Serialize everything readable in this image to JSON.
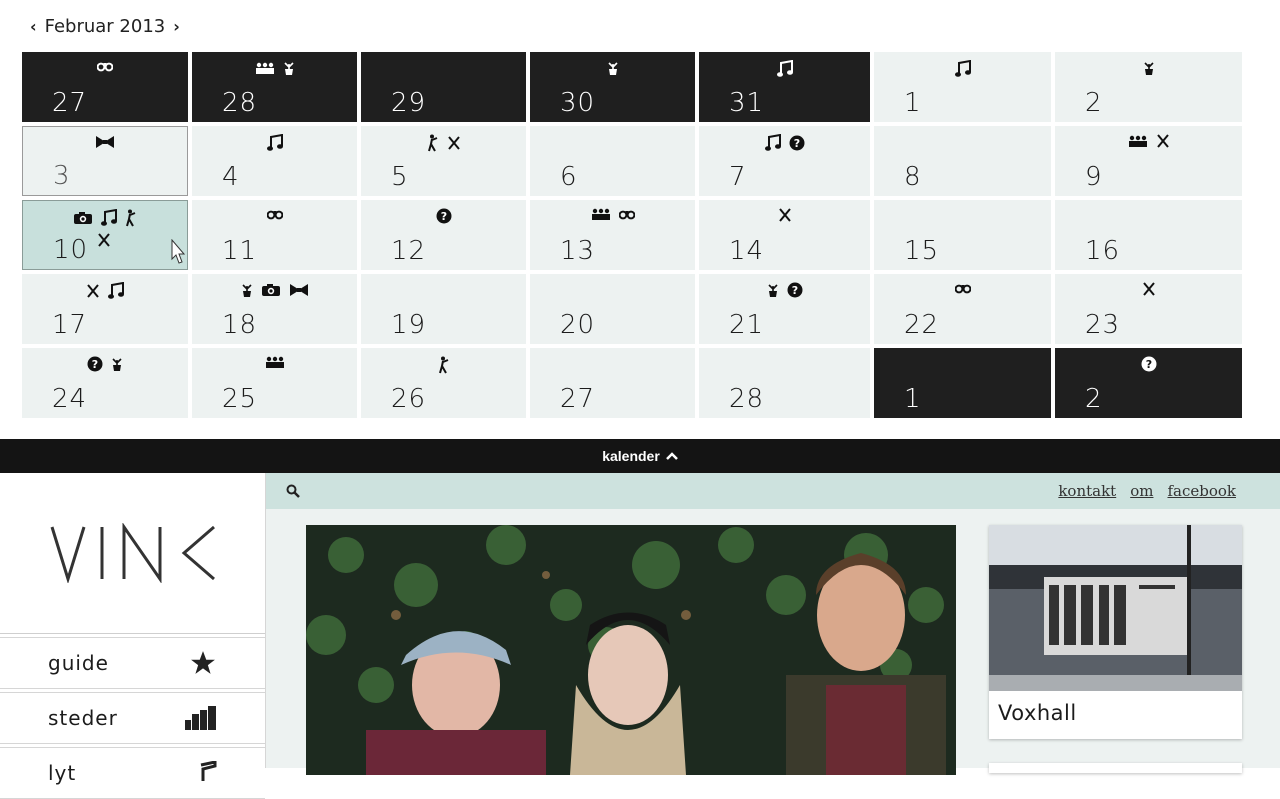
{
  "calendar": {
    "month_label": "Februar 2013",
    "prev_glyph": "‹",
    "next_glyph": "›",
    "weeks": [
      [
        {
          "day": "27",
          "style": "dark",
          "icons": [
            "binoculars-icon"
          ]
        },
        {
          "day": "28",
          "style": "dark",
          "icons": [
            "audience-icon",
            "plant-icon"
          ]
        },
        {
          "day": "29",
          "style": "dark",
          "icons": []
        },
        {
          "day": "30",
          "style": "dark",
          "icons": [
            "plant-icon"
          ]
        },
        {
          "day": "31",
          "style": "dark",
          "icons": [
            "music-note-icon"
          ]
        },
        {
          "day": "1",
          "style": "light",
          "icons": [
            "music-note-icon"
          ]
        },
        {
          "day": "2",
          "style": "light",
          "icons": [
            "plant-icon"
          ]
        }
      ],
      [
        {
          "day": "3",
          "style": "outlined",
          "icons": [
            "bowtie-icon"
          ]
        },
        {
          "day": "4",
          "style": "light",
          "icons": [
            "music-note-icon"
          ]
        },
        {
          "day": "5",
          "style": "light",
          "icons": [
            "dancer-icon",
            "cutlery-icon"
          ]
        },
        {
          "day": "6",
          "style": "light",
          "icons": []
        },
        {
          "day": "7",
          "style": "light",
          "icons": [
            "music-note-icon",
            "question-icon"
          ]
        },
        {
          "day": "8",
          "style": "light",
          "icons": []
        },
        {
          "day": "9",
          "style": "light",
          "icons": [
            "audience-icon",
            "cutlery-icon"
          ]
        }
      ],
      [
        {
          "day": "10",
          "style": "selected",
          "icons": [
            "camera-icon",
            "music-note-icon",
            "dancer-icon"
          ],
          "icons_row2": [
            "cutlery-icon"
          ]
        },
        {
          "day": "11",
          "style": "light",
          "icons": [
            "binoculars-icon"
          ]
        },
        {
          "day": "12",
          "style": "light",
          "icons": [
            "question-icon"
          ]
        },
        {
          "day": "13",
          "style": "light",
          "icons": [
            "audience-icon",
            "binoculars-icon"
          ]
        },
        {
          "day": "14",
          "style": "light",
          "icons": [
            "cutlery-icon"
          ]
        },
        {
          "day": "15",
          "style": "light",
          "icons": []
        },
        {
          "day": "16",
          "style": "light",
          "icons": []
        }
      ],
      [
        {
          "day": "17",
          "style": "light",
          "icons": [
            "cutlery-icon",
            "music-note-icon"
          ]
        },
        {
          "day": "18",
          "style": "light",
          "icons": [
            "plant-icon",
            "camera-icon",
            "bowtie-icon"
          ]
        },
        {
          "day": "19",
          "style": "light",
          "icons": []
        },
        {
          "day": "20",
          "style": "light",
          "icons": []
        },
        {
          "day": "21",
          "style": "light",
          "icons": [
            "plant-icon",
            "question-icon"
          ]
        },
        {
          "day": "22",
          "style": "light",
          "icons": [
            "binoculars-icon"
          ]
        },
        {
          "day": "23",
          "style": "light",
          "icons": [
            "cutlery-icon"
          ]
        }
      ],
      [
        {
          "day": "24",
          "style": "light",
          "icons": [
            "question-icon",
            "plant-icon"
          ]
        },
        {
          "day": "25",
          "style": "light",
          "icons": [
            "audience-icon"
          ]
        },
        {
          "day": "26",
          "style": "light",
          "icons": [
            "dancer-icon"
          ]
        },
        {
          "day": "27",
          "style": "light",
          "icons": []
        },
        {
          "day": "28",
          "style": "light",
          "icons": []
        },
        {
          "day": "1",
          "style": "dark",
          "icons": []
        },
        {
          "day": "2",
          "style": "dark",
          "icons": [
            "question-icon"
          ]
        }
      ]
    ]
  },
  "kalender_bar": {
    "label": "kalender",
    "arrow": "⌃"
  },
  "sidebar": {
    "logo_text": "VINK",
    "items": [
      {
        "label": "guide",
        "icon": "star-icon"
      },
      {
        "label": "steder",
        "icon": "buildings-icon"
      },
      {
        "label": "lyt",
        "icon": "music-note-icon"
      }
    ]
  },
  "topbar": {
    "search_icon": "search-icon",
    "links": [
      "kontakt",
      "om",
      "facebook"
    ]
  },
  "venue_card": {
    "name": "Voxhall"
  },
  "colors": {
    "dark_cell": "#1f1f1f",
    "light_cell": "#edf2f1",
    "selected_cell": "#c8e0dc",
    "topbar": "#cde2de",
    "bar": "#141414"
  }
}
